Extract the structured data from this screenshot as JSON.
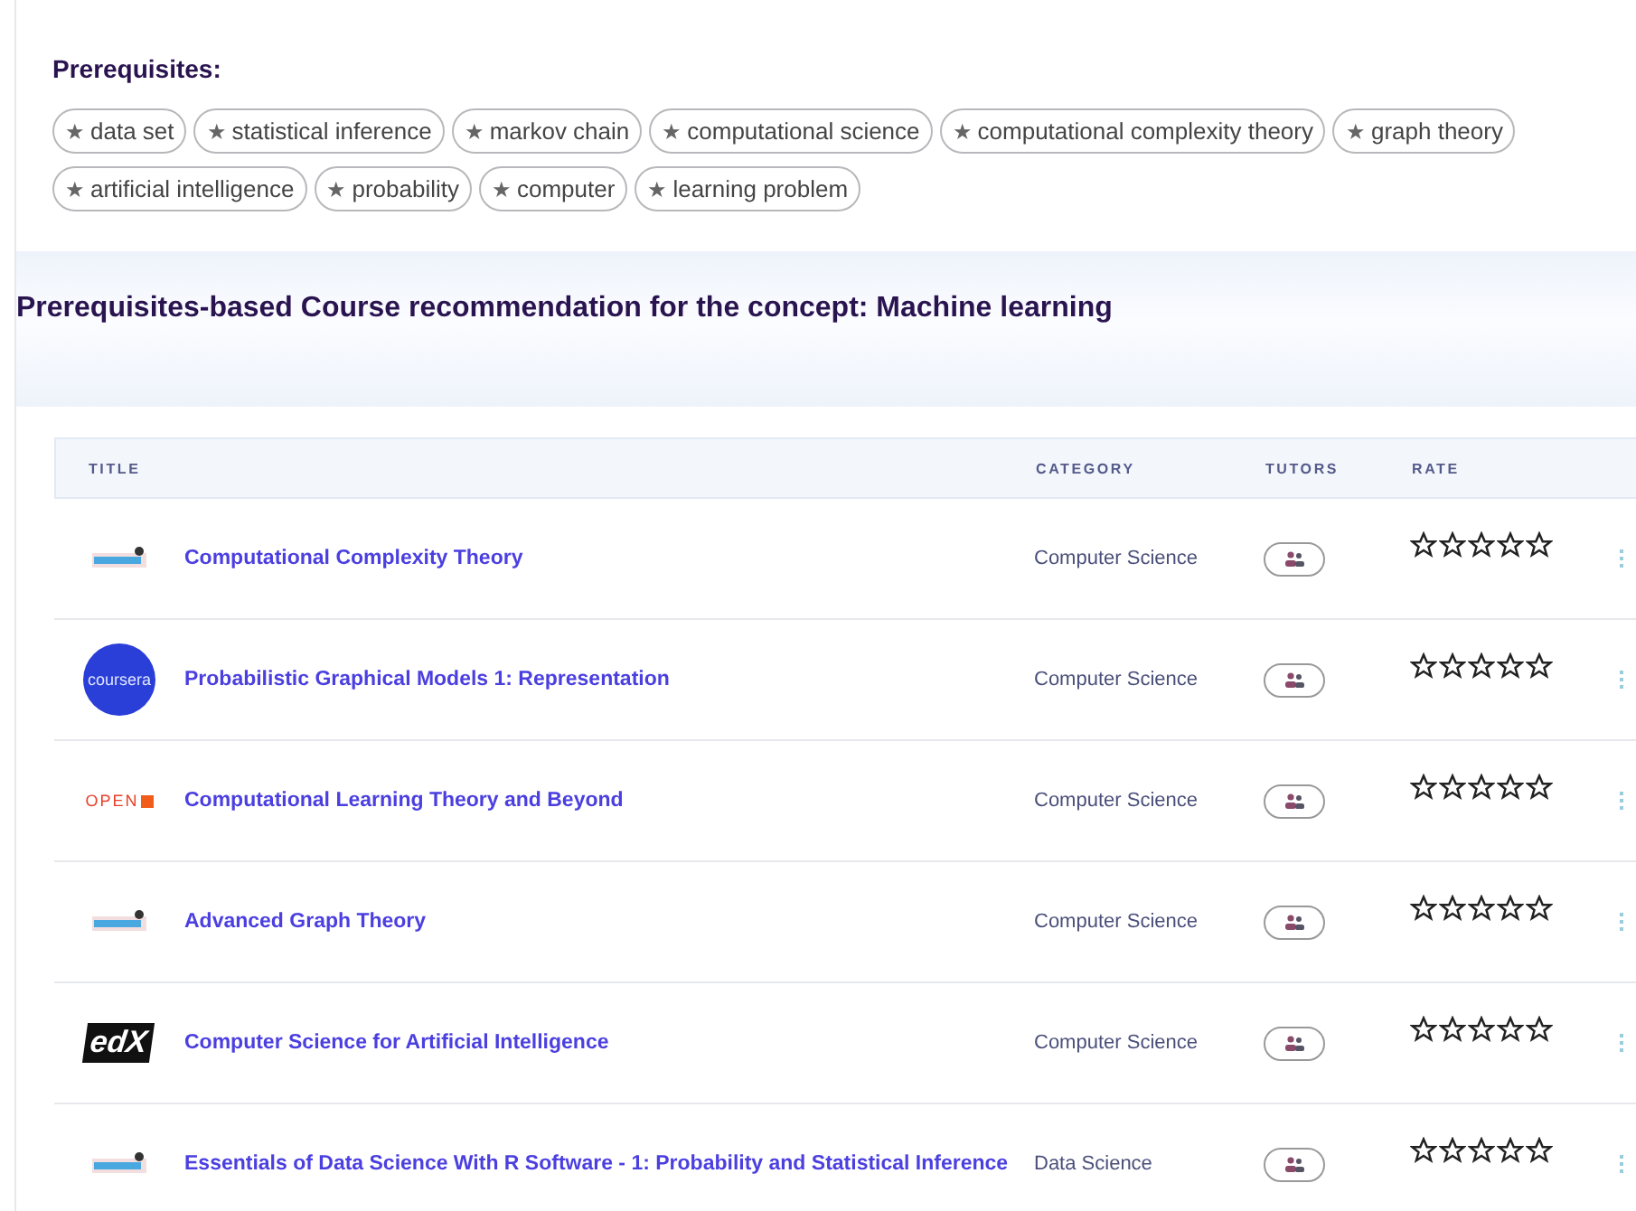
{
  "prerequisites": {
    "heading": "Prerequisites:",
    "tags": [
      {
        "icon": "★",
        "label": "data set"
      },
      {
        "icon": "★",
        "label": "statistical inference"
      },
      {
        "icon": "★",
        "label": "markov chain"
      },
      {
        "icon": "★",
        "label": "computational science"
      },
      {
        "icon": "★",
        "label": "computational complexity theory"
      },
      {
        "icon": "★",
        "label": "graph theory"
      },
      {
        "icon": "★",
        "label": "artificial intelligence"
      },
      {
        "icon": "★",
        "label": "probability"
      },
      {
        "icon": "★",
        "label": "computer"
      },
      {
        "icon": "★",
        "label": "learning problem"
      }
    ]
  },
  "recommendation": {
    "heading": "Prerequisites-based Course recommendation for the concept: Machine learning"
  },
  "table": {
    "columns": [
      "TITLE",
      "CATEGORY",
      "TUTORS",
      "RATE"
    ],
    "rows": [
      {
        "kind": "swayam",
        "title": "Computational Complexity Theory",
        "category": "Computer Science",
        "stars": 0
      },
      {
        "kind": "coursera",
        "logo_text": "coursera",
        "title": "Probabilistic Graphical Models 1: Representation",
        "category": "Computer Science",
        "stars": 0
      },
      {
        "kind": "open",
        "logo_text": "OPEN",
        "title": "Computational Learning Theory and Beyond",
        "category": "Computer Science",
        "stars": 0
      },
      {
        "kind": "swayam",
        "title": "Advanced Graph Theory",
        "category": "Computer Science",
        "stars": 0
      },
      {
        "kind": "edx",
        "logo_text": "edX",
        "title": "Computer Science for Artificial Intelligence",
        "category": "Computer Science",
        "stars": 0
      },
      {
        "kind": "swayam",
        "title": "Essentials of Data Science With R Software - 1: Probability and Statistical Inference",
        "category": "Data Science",
        "stars": 0
      }
    ]
  }
}
